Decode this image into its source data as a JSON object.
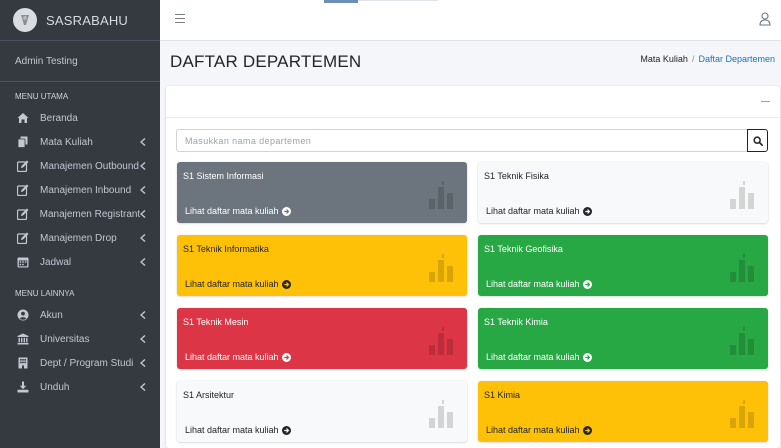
{
  "brand": {
    "name": "SASRABAHU"
  },
  "user": {
    "name": "Admin Testing"
  },
  "sidebar": {
    "header_main": "MENU UTAMA",
    "header_other": "MENU LAINNYA",
    "main_items": [
      {
        "label": "Beranda",
        "icon": "home-icon",
        "has_submenu": false
      },
      {
        "label": "Mata Kuliah",
        "icon": "copy-icon",
        "has_submenu": true
      },
      {
        "label": "Manajemen Outbound",
        "icon": "edit-icon",
        "has_submenu": true
      },
      {
        "label": "Manajemen Inbound",
        "icon": "edit-icon",
        "has_submenu": true
      },
      {
        "label": "Manajemen Registrant",
        "icon": "edit-icon",
        "has_submenu": true
      },
      {
        "label": "Manajemen Drop",
        "icon": "edit-icon",
        "has_submenu": true
      },
      {
        "label": "Jadwal",
        "icon": "calendar-icon",
        "has_submenu": true
      }
    ],
    "other_items": [
      {
        "label": "Akun",
        "icon": "user-circle-icon",
        "has_submenu": true
      },
      {
        "label": "Universitas",
        "icon": "university-icon",
        "has_submenu": true
      },
      {
        "label": "Dept / Program Studi",
        "icon": "building-icon",
        "has_submenu": true
      },
      {
        "label": "Unduh",
        "icon": "download-icon",
        "has_submenu": true
      }
    ]
  },
  "page": {
    "title": "DAFTAR DEPARTEMEN",
    "breadcrumb": {
      "parent": "Mata Kuliah",
      "separator": "/",
      "current": "Daftar Departemen"
    }
  },
  "search": {
    "placeholder": "Masukkan nama departemen",
    "value": ""
  },
  "departments": [
    {
      "name": "S1 Sistem Informasi",
      "link": "Lihat daftar mata kuliah",
      "color": "#6c757d"
    },
    {
      "name": "S1 Teknik Fisika",
      "link": "Lihat daftar mata kuliah",
      "color": "#f8f9fa"
    },
    {
      "name": "S1 Teknik Informatika",
      "link": "Lihat daftar mata kuliah",
      "color": "#ffc107"
    },
    {
      "name": "S1 Teknik Geofisika",
      "link": "Lihat daftar mata kuliah",
      "color": "#28a745"
    },
    {
      "name": "S1 Teknik Mesin",
      "link": "Lihat daftar mata kuliah",
      "color": "#dc3545"
    },
    {
      "name": "S1 Teknik Kimia",
      "link": "Lihat daftar mata kuliah",
      "color": "#28a745"
    },
    {
      "name": "S1 Arsitektur",
      "link": "Lihat daftar mata kuliah",
      "color": "#f8f9fa"
    },
    {
      "name": "S1 Kimia",
      "link": "Lihat daftar mata kuliah",
      "color": "#ffc107"
    }
  ],
  "colors": {
    "sidebar_bg": "#343a40",
    "link_active": "#1d72b8",
    "box_gray": "#6c757d",
    "box_light": "#f8f9fa",
    "box_yellow": "#ffc107",
    "box_green": "#28a745",
    "box_red": "#dc3545"
  }
}
